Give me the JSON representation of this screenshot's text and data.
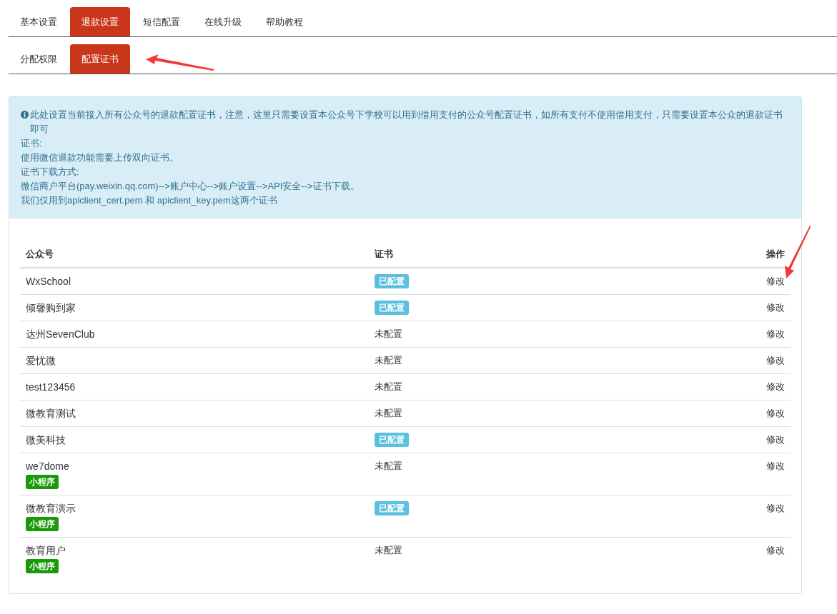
{
  "tabs": [
    {
      "label": "基本设置",
      "selected": false
    },
    {
      "label": "退款设置",
      "selected": true
    },
    {
      "label": "短信配置",
      "selected": false
    },
    {
      "label": "在线升级",
      "selected": false
    },
    {
      "label": "帮助教程",
      "selected": false
    }
  ],
  "subtabs": [
    {
      "label": "分配权限",
      "selected": false
    },
    {
      "label": "配置证书",
      "selected": true
    }
  ],
  "notice": {
    "lines": [
      "此处设置当前接入所有公众号的退款配置证书，注意，这里只需要设置本公众号下学校可以用到借用支付的公众号配置证书，如所有支付不使用借用支付，只需要设置本公众的退款证书即可",
      "证书:",
      "使用微信退款功能需要上传双向证书。",
      "证书下载方式:",
      "微信商户平台(pay.weixin.qq.com)-->账户中心-->账户设置-->API安全-->证书下载。",
      "我们仅用到apiclient_cert.pem 和 apiclient_key.pem这两个证书"
    ]
  },
  "table": {
    "columns": [
      "公众号",
      "证书",
      "操作"
    ],
    "rows": [
      {
        "name": "WxSchool",
        "cert": "已配置",
        "configured": true,
        "action": "修改"
      },
      {
        "name": "倾馨购到家",
        "cert": "已配置",
        "configured": true,
        "action": "修改"
      },
      {
        "name": "达州SevenClub",
        "cert": "未配置",
        "configured": false,
        "action": "修改"
      },
      {
        "name": "爱忧微",
        "cert": "未配置",
        "configured": false,
        "action": "修改"
      },
      {
        "name": "test123456",
        "cert": "未配置",
        "configured": false,
        "action": "修改"
      },
      {
        "name": "微教育测试",
        "cert": "未配置",
        "configured": false,
        "action": "修改"
      },
      {
        "name": "微美科技",
        "cert": "已配置",
        "configured": true,
        "action": "修改"
      },
      {
        "name": "we7dome",
        "tag": "小程序",
        "cert": "未配置",
        "configured": false,
        "action": "修改"
      },
      {
        "name": "微教育演示",
        "tag": "小程序",
        "cert": "已配置",
        "configured": true,
        "action": "修改"
      },
      {
        "name": "教育用户",
        "tag": "小程序",
        "cert": "未配置",
        "configured": false,
        "action": "修改"
      }
    ]
  }
}
